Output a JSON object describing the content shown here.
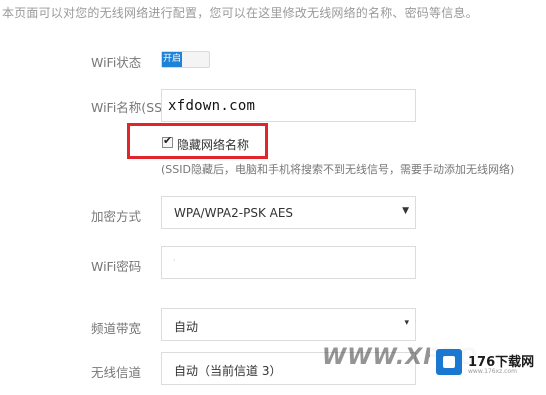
{
  "intro_text": "本页面可以对您的无线网络进行配置，您可以在这里修改无线网络的名称、密码等信息。",
  "wifi_status": {
    "label": "WiFi状态",
    "toggle_text": "开启",
    "enabled": true
  },
  "ssid": {
    "label": "WiFi名称(SSID)",
    "value": "xfdown.com",
    "hide_checkbox_label": "隐藏网络名称",
    "hide_checked": true,
    "hint": "(SSID隐藏后，电脑和手机将搜索不到无线信号，需要手动添加无线网络)"
  },
  "encryption": {
    "label": "加密方式",
    "selected": "WPA/WPA2-PSK AES"
  },
  "password": {
    "label": "WiFi密码",
    "value": "·"
  },
  "bandwidth": {
    "label": "频道带宽",
    "selected": "自动"
  },
  "channel": {
    "label": "无线信道",
    "selected": "自动（当前信道 3）"
  },
  "watermark": {
    "text": "WWW.XFDO",
    "brand": "176下载网",
    "sub": "www.176xz.com"
  },
  "colors": {
    "toggle_on": "#1e82d8",
    "highlight_border": "#e0262a"
  },
  "icons": {
    "checkbox": "checkmark-icon",
    "select_arrow": "caret-down-icon"
  }
}
